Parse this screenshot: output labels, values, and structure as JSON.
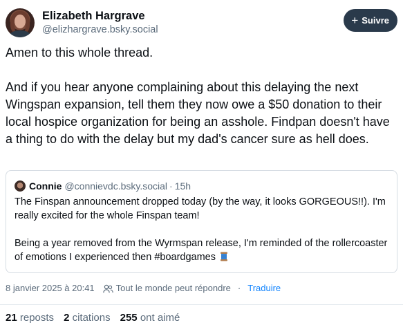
{
  "author": {
    "display_name": "Elizabeth Hargrave",
    "handle": "@elizhargrave.bsky.social",
    "follow_label": "Suivre"
  },
  "post": {
    "paragraphs": [
      "Amen to this whole thread.",
      "And if you hear anyone complaining about this delaying the next Wingspan expansion, tell them they now owe a $50 donation to their local hospice organization for being an asshole. Findpan doesn't have a thing to do with the delay but my dad's cancer sure as hell does."
    ]
  },
  "quote": {
    "name": "Connie",
    "handle": "@connievdc.bsky.social",
    "separator": "·",
    "time": "15h",
    "paragraphs": [
      "The Finspan announcement dropped today (by the way, it looks GORGEOUS!!). I'm really excited for the whole Finspan team!",
      "Being a year removed from the Wyrmspan release, I'm reminded of the rollercoaster of emotions I experienced then #boardgames"
    ],
    "trailing_icon": "spool-of-thread-icon"
  },
  "meta": {
    "timestamp": "8 janvier 2025 à 20:41",
    "reply_setting": "Tout le monde peut répondre",
    "separator": "·",
    "translate_label": "Traduire"
  },
  "stats": {
    "reposts_count": "21",
    "reposts_label": "reposts",
    "citations_count": "2",
    "citations_label": "citations",
    "likes_count": "255",
    "likes_label": "ont aimé"
  },
  "colors": {
    "follow_bg": "#2a3a4b",
    "link": "#1083fe",
    "muted": "#5b6b7b",
    "border": "#d4dbe2"
  }
}
